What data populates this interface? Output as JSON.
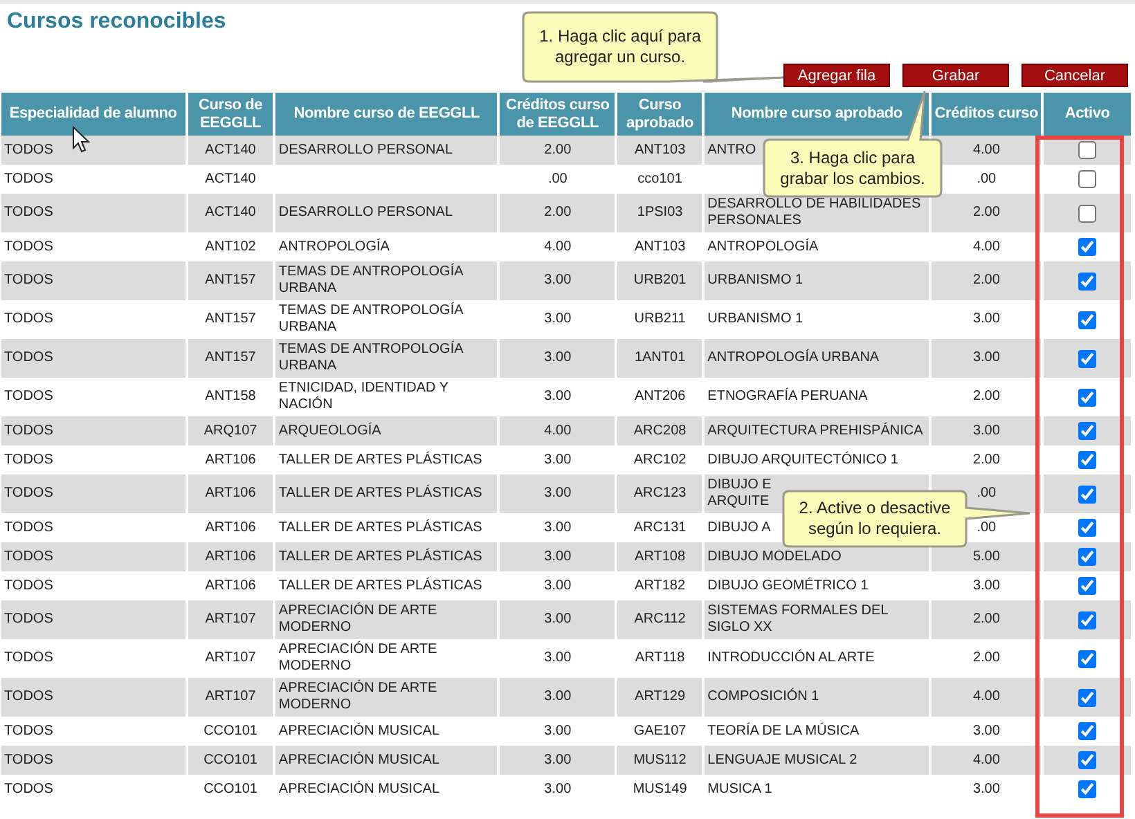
{
  "title": "Cursos reconocibles",
  "buttons": [
    {
      "label": "Agregar fila"
    },
    {
      "label": "Grabar"
    },
    {
      "label": "Cancelar"
    }
  ],
  "table": {
    "columns": [
      "Especialidad de alumno",
      "Curso de EEGGLL",
      "Nombre curso de EEGGLL",
      "Créditos curso de EEGGLL",
      "Curso aprobado",
      "Nombre curso aprobado",
      "Créditos curso",
      "Activo"
    ],
    "rows": [
      {
        "specialty": "TODOS",
        "course": "ACT140",
        "course_name": "DESARROLLO PERSONAL",
        "credits": "2.00",
        "approved": "ANT103",
        "approved_name": "ANTRO",
        "approved_credits": "4.00",
        "checked": false
      },
      {
        "specialty": "TODOS",
        "course": "ACT140",
        "credits": ".00",
        "approved": "cco101",
        "approved_credits": ".00",
        "checked": false
      },
      {
        "specialty": "TODOS",
        "course": "ACT140",
        "course_name": "DESARROLLO PERSONAL",
        "credits": "2.00",
        "approved": "1PSI03",
        "approved_name": "DESARROLLO DE HABILIDADES PERSONALES",
        "approved_credits": "2.00",
        "checked": false
      },
      {
        "specialty": "TODOS",
        "course": "ANT102",
        "course_name": "ANTROPOLOGÍA",
        "credits": "4.00",
        "approved": "ANT103",
        "approved_name": "ANTROPOLOGÍA",
        "approved_credits": "4.00",
        "checked": true
      },
      {
        "specialty": "TODOS",
        "course": "ANT157",
        "course_name": "TEMAS DE ANTROPOLOGÍA URBANA",
        "credits": "3.00",
        "approved": "URB201",
        "approved_name": "URBANISMO 1",
        "approved_credits": "2.00",
        "checked": true
      },
      {
        "specialty": "TODOS",
        "course": "ANT157",
        "course_name": "TEMAS DE ANTROPOLOGÍA URBANA",
        "credits": "3.00",
        "approved": "URB211",
        "approved_name": "URBANISMO 1",
        "approved_credits": "3.00",
        "checked": true
      },
      {
        "specialty": "TODOS",
        "course": "ANT157",
        "course_name": "TEMAS DE ANTROPOLOGÍA URBANA",
        "credits": "3.00",
        "approved": "1ANT01",
        "approved_name": "ANTROPOLOGÍA URBANA",
        "approved_credits": "3.00",
        "checked": true
      },
      {
        "specialty": "TODOS",
        "course": "ANT158",
        "course_name": "ETNICIDAD, IDENTIDAD Y NACIÓN",
        "credits": "3.00",
        "approved": "ANT206",
        "approved_name": "ETNOGRAFÍA PERUANA",
        "approved_credits": "2.00",
        "checked": true
      },
      {
        "specialty": "TODOS",
        "course": "ARQ107",
        "course_name": "ARQUEOLOGÍA",
        "credits": "4.00",
        "approved": "ARC208",
        "approved_name": "ARQUITECTURA PREHISPÁNICA",
        "approved_credits": "3.00",
        "checked": true
      },
      {
        "specialty": "TODOS",
        "course": "ART106",
        "course_name": "TALLER DE ARTES PLÁSTICAS",
        "credits": "3.00",
        "approved": "ARC102",
        "approved_name": "DIBUJO ARQUITECTÓNICO 1",
        "approved_credits": "2.00",
        "checked": true
      },
      {
        "specialty": "TODOS",
        "course": "ART106",
        "course_name": "TALLER DE ARTES PLÁSTICAS",
        "credits": "3.00",
        "approved": "ARC123",
        "approved_name": [
          "DIBUJO E",
          "ARQUITE"
        ],
        "approved_credits": ".00",
        "checked": true
      },
      {
        "specialty": "TODOS",
        "course": "ART106",
        "course_name": "TALLER DE ARTES PLÁSTICAS",
        "credits": "3.00",
        "approved": "ARC131",
        "approved_name": "DIBUJO A",
        "approved_credits": ".00",
        "checked": true
      },
      {
        "specialty": "TODOS",
        "course": "ART106",
        "course_name": "TALLER DE ARTES PLÁSTICAS",
        "credits": "3.00",
        "approved": "ART108",
        "approved_name": "DIBUJO MODELADO",
        "approved_credits": "5.00",
        "checked": true
      },
      {
        "specialty": "TODOS",
        "course": "ART106",
        "course_name": "TALLER DE ARTES PLÁSTICAS",
        "credits": "3.00",
        "approved": "ART182",
        "approved_name": "DIBUJO GEOMÉTRICO 1",
        "approved_credits": "3.00",
        "checked": true
      },
      {
        "specialty": "TODOS",
        "course": "ART107",
        "course_name": "APRECIACIÓN DE ARTE MODERNO",
        "credits": "3.00",
        "approved": "ARC112",
        "approved_name": "SISTEMAS FORMALES DEL SIGLO XX",
        "approved_credits": "2.00",
        "checked": true
      },
      {
        "specialty": "TODOS",
        "course": "ART107",
        "course_name": "APRECIACIÓN DE ARTE MODERNO",
        "credits": "3.00",
        "approved": "ART118",
        "approved_name": "INTRODUCCIÓN AL ARTE",
        "approved_credits": "2.00",
        "checked": true
      },
      {
        "specialty": "TODOS",
        "course": "ART107",
        "course_name": "APRECIACIÓN DE ARTE MODERNO",
        "credits": "3.00",
        "approved": "ART129",
        "approved_name": "COMPOSICIÓN 1",
        "approved_credits": "4.00",
        "checked": true
      },
      {
        "specialty": "TODOS",
        "course": "CCO101",
        "course_name": "APRECIACIÓN MUSICAL",
        "credits": "3.00",
        "approved": "GAE107",
        "approved_name": "TEORÍA DE LA MÚSICA",
        "approved_credits": "3.00",
        "checked": true
      },
      {
        "specialty": "TODOS",
        "course": "CCO101",
        "course_name": "APRECIACIÓN MUSICAL",
        "credits": "3.00",
        "approved": "MUS112",
        "approved_name": "LENGUAJE MUSICAL 2",
        "approved_credits": "4.00",
        "checked": true
      },
      {
        "specialty": "TODOS",
        "course": "CCO101",
        "course_name": "APRECIACIÓN MUSICAL",
        "credits": "3.00",
        "approved": "MUS149",
        "approved_name": "MUSICA 1",
        "approved_credits": "3.00",
        "checked": true
      }
    ]
  },
  "callouts": [
    {
      "text": "1. Haga clic aquí para agregar un curso."
    },
    {
      "text": "3. Haga clic para grabar los cambios."
    },
    {
      "text": "2. Active o desactive según lo requiera."
    }
  ]
}
